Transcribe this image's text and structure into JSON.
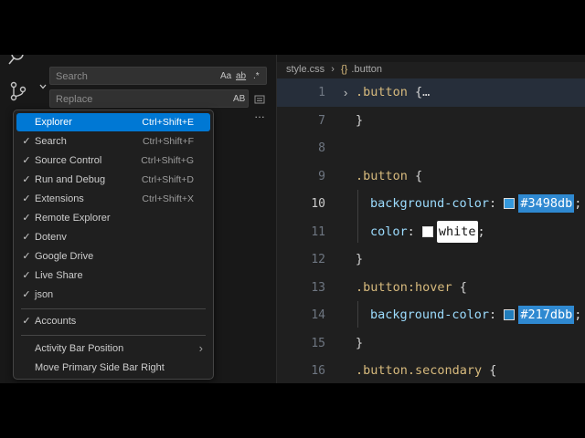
{
  "search": {
    "placeholder": "Search",
    "opt_case": "Aa",
    "opt_word": "ab",
    "opt_regex": ".*"
  },
  "replace": {
    "placeholder": "Replace",
    "opt_preserve": "AB"
  },
  "sidebar": {
    "more": "…"
  },
  "context_menu": {
    "items": [
      {
        "label": "Explorer",
        "shortcut": "Ctrl+Shift+E",
        "checked": "",
        "active": true
      },
      {
        "label": "Search",
        "shortcut": "Ctrl+Shift+F",
        "checked": "✓"
      },
      {
        "label": "Source Control",
        "shortcut": "Ctrl+Shift+G",
        "checked": "✓"
      },
      {
        "label": "Run and Debug",
        "shortcut": "Ctrl+Shift+D",
        "checked": "✓"
      },
      {
        "label": "Extensions",
        "shortcut": "Ctrl+Shift+X",
        "checked": "✓"
      },
      {
        "label": "Remote Explorer",
        "shortcut": "",
        "checked": "✓"
      },
      {
        "label": "Dotenv",
        "shortcut": "",
        "checked": "✓"
      },
      {
        "label": "Google Drive",
        "shortcut": "",
        "checked": "✓"
      },
      {
        "label": "Live Share",
        "shortcut": "",
        "checked": "✓"
      },
      {
        "label": "json",
        "shortcut": "",
        "checked": "✓"
      }
    ],
    "accounts": {
      "label": "Accounts",
      "checked": "✓"
    },
    "activity_bar_position": {
      "label": "Activity Bar Position",
      "arrow": "›"
    },
    "move_side_bar": {
      "label": "Move Primary Side Bar Right"
    }
  },
  "breadcrumb": {
    "file": "style.css",
    "sep": "›",
    "symbol_icon": "{}",
    "symbol": ".button"
  },
  "editor": {
    "lines": [
      {
        "num": "1",
        "fold": "›",
        "selector": ".button",
        "rest": " {…"
      },
      {
        "num": "7",
        "text": "}"
      },
      {
        "num": "8",
        "text": ""
      },
      {
        "num": "9",
        "selector": ".button",
        "rest": " {"
      },
      {
        "num": "10",
        "prop": "background-color",
        "colon": ": ",
        "value": "#3498db",
        "swatch": "#3498db",
        "current": true
      },
      {
        "num": "11",
        "prop": "color",
        "colon": ": ",
        "value": "white",
        "swatch": "#ffffff"
      },
      {
        "num": "12",
        "text": "}"
      },
      {
        "num": "13",
        "selector": ".button:hover",
        "rest": " {"
      },
      {
        "num": "14",
        "prop": "background-color",
        "colon": ": ",
        "value": "#217dbb",
        "swatch": "#217dbb"
      },
      {
        "num": "15",
        "text": "}"
      },
      {
        "num": "16",
        "selector": ".button.secondary",
        "rest": " {"
      }
    ]
  },
  "colors": {
    "menu_active": "#0078d4",
    "highlight": "#2f89d1",
    "selector": "#d7ba7d",
    "property": "#9cdcfe"
  },
  "icons": [
    "search-icon",
    "source-control-icon",
    "chevron-down-icon",
    "replace-all-icon",
    "check-icon",
    "chevron-right-icon",
    "symbol-class-icon"
  ]
}
